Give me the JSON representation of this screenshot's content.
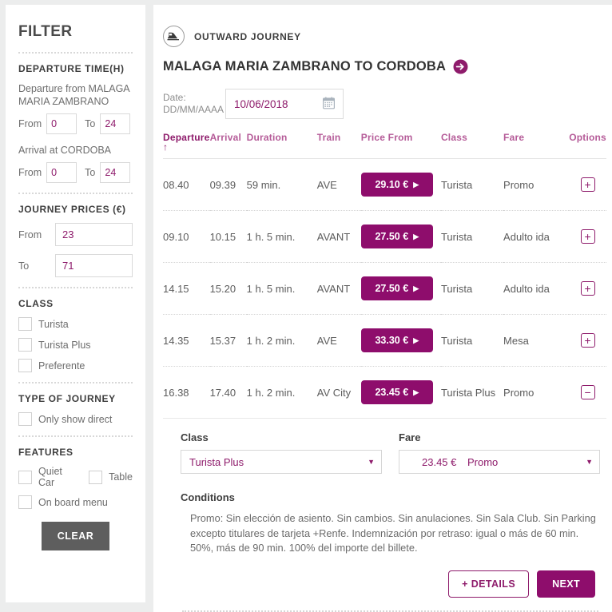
{
  "sidebar": {
    "title": "FILTER",
    "departure_time": {
      "heading": "DEPARTURE TIME(H)",
      "departure_label": "Departure from MALAGA MARIA ZAMBRANO",
      "departure_from_label": "From",
      "departure_from_value": "0",
      "departure_to_label": "To",
      "departure_to_value": "24",
      "arrival_label": "Arrival at CORDOBA",
      "arrival_from_label": "From",
      "arrival_from_value": "0",
      "arrival_to_label": "To",
      "arrival_to_value": "24"
    },
    "journey_prices": {
      "heading": "JOURNEY PRICES (€)",
      "from_label": "From",
      "from_value": "23",
      "to_label": "To",
      "to_value": "71"
    },
    "class": {
      "heading": "CLASS",
      "options": [
        {
          "label": "Turista",
          "checked": false
        },
        {
          "label": "Turista Plus",
          "checked": false
        },
        {
          "label": "Preferente",
          "checked": false
        }
      ]
    },
    "type_of_journey": {
      "heading": "TYPE OF JOURNEY",
      "options": [
        {
          "label": "Only show direct",
          "checked": false
        }
      ]
    },
    "features": {
      "heading": "FEATURES",
      "quiet_car": "Quiet Car",
      "table": "Table",
      "on_board_menu": "On board menu"
    },
    "clear_button": "CLEAR"
  },
  "main": {
    "journey_kind": "OUTWARD JOURNEY",
    "train_icon": "train-icon",
    "route_title": "MALAGA MARIA ZAMBRANO TO CORDOBA",
    "route_arrow_icon": "arrow-right-circle-icon",
    "date": {
      "label_line1": "Date:",
      "label_line2": "DD/MM/AAAA",
      "value": "10/06/2018",
      "calendar_icon": "calendar-icon"
    },
    "table": {
      "headers": {
        "departure": "Departure",
        "sort_indicator": "↑",
        "arrival": "Arrival",
        "duration": "Duration",
        "train": "Train",
        "price_from": "Price From",
        "class": "Class",
        "fare": "Fare",
        "options": "Options"
      },
      "rows": [
        {
          "departure": "08.40",
          "arrival": "09.39",
          "duration": "59 min.",
          "train": "AVE",
          "price": "29.10 €",
          "class": "Turista",
          "fare": "Promo",
          "toggle": "+"
        },
        {
          "departure": "09.10",
          "arrival": "10.15",
          "duration": "1 h. 5 min.",
          "train": "AVANT",
          "price": "27.50 €",
          "class": "Turista",
          "fare": "Adulto ida",
          "toggle": "+"
        },
        {
          "departure": "14.15",
          "arrival": "15.20",
          "duration": "1 h. 5 min.",
          "train": "AVANT",
          "price": "27.50 €",
          "class": "Turista",
          "fare": "Adulto ida",
          "toggle": "+"
        },
        {
          "departure": "14.35",
          "arrival": "15.37",
          "duration": "1 h. 2 min.",
          "train": "AVE",
          "price": "33.30 €",
          "class": "Turista",
          "fare": "Mesa",
          "toggle": "+"
        },
        {
          "departure": "16.38",
          "arrival": "17.40",
          "duration": "1 h. 2 min.",
          "train": "AV City",
          "price": "23.45 €",
          "class": "Turista Plus",
          "fare": "Promo",
          "toggle": "−"
        }
      ]
    },
    "detail": {
      "class_title": "Class",
      "class_value": "Turista Plus",
      "fare_title": "Fare",
      "fare_price": "23.45 €",
      "fare_value": "Promo",
      "conditions_title": "Conditions",
      "conditions_text": "Promo:  Sin elección de asiento.  Sin cambios.  Sin anulaciones.  Sin Sala Club. Sin Parking excepto titulares de tarjeta +Renfe. Indemnización por retraso: igual o más de 60 min. 50%, más de 90 min. 100% del importe del billete.",
      "details_button": "+ DETAILS",
      "next_button": "NEXT"
    }
  },
  "colors": {
    "brand_purple": "#8e0d6c",
    "accent_purple": "#8e1b6b",
    "header_pink": "#b55b98",
    "clear_gray": "#5e5e5e",
    "page_bg": "#eceded"
  }
}
